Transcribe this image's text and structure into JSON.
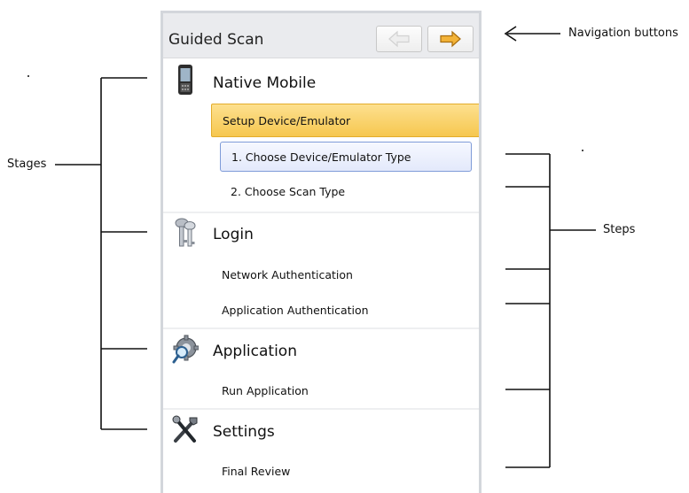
{
  "panel": {
    "title": "Guided Scan",
    "nav": {
      "back_icon": "arrow-left-icon",
      "next_icon": "arrow-right-icon"
    },
    "stages": [
      {
        "label": "Native Mobile",
        "icon": "mobile-phone-icon",
        "selected_group": "Setup Device/Emulator",
        "steps": [
          "1. Choose Device/Emulator Type",
          "2. Choose Scan Type"
        ]
      },
      {
        "label": "Login",
        "icon": "keys-icon",
        "steps": [
          "Network Authentication",
          "Application Authentication"
        ]
      },
      {
        "label": "Application",
        "icon": "gear-magnifier-icon",
        "steps": [
          "Run Application"
        ]
      },
      {
        "label": "Settings",
        "icon": "tools-icon",
        "steps": [
          "Final Review"
        ]
      }
    ]
  },
  "annotations": {
    "stages": "Stages",
    "steps": "Steps",
    "navigation": "Navigation buttons"
  },
  "colors": {
    "active_stage": "#f6c74f",
    "active_step_border": "#7e9bd8",
    "header_bg": "#eaebee",
    "panel_border": "#d3d6db"
  }
}
